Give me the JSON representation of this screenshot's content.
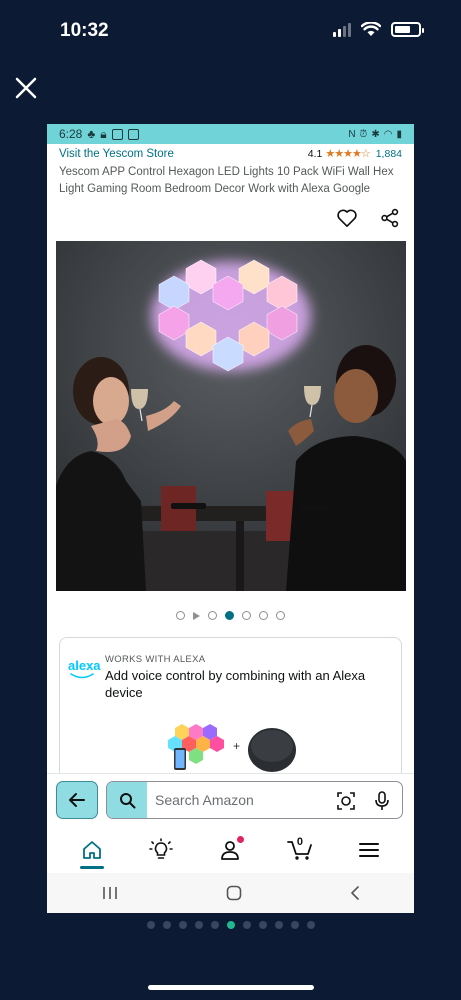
{
  "status_bar": {
    "time": "10:32"
  },
  "inner_status": {
    "time": "6:28",
    "indicators": "N"
  },
  "product": {
    "store_link": "Visit the Yescom Store",
    "rating": "4.1",
    "review_count": "1,884",
    "title": "Yescom APP Control Hexagon LED Lights 10 Pack WiFi Wall Hex Light Gaming Room Bedroom Decor Work with Alexa Google"
  },
  "alexa": {
    "logo": "alexa",
    "works_with": "WORKS WITH ALEXA",
    "description": "Add voice control by combining with an Alexa device",
    "plus": "+"
  },
  "search": {
    "placeholder": "Search Amazon"
  },
  "cart": {
    "count": "0"
  },
  "image_dots": {
    "total": 7,
    "active_index": 3
  },
  "outer_dots": {
    "total": 11,
    "active_index": 5
  },
  "colors": {
    "accent": "#007185",
    "search_teal": "#8fdce2",
    "status_teal": "#70d3d8",
    "star": "#de7921"
  }
}
